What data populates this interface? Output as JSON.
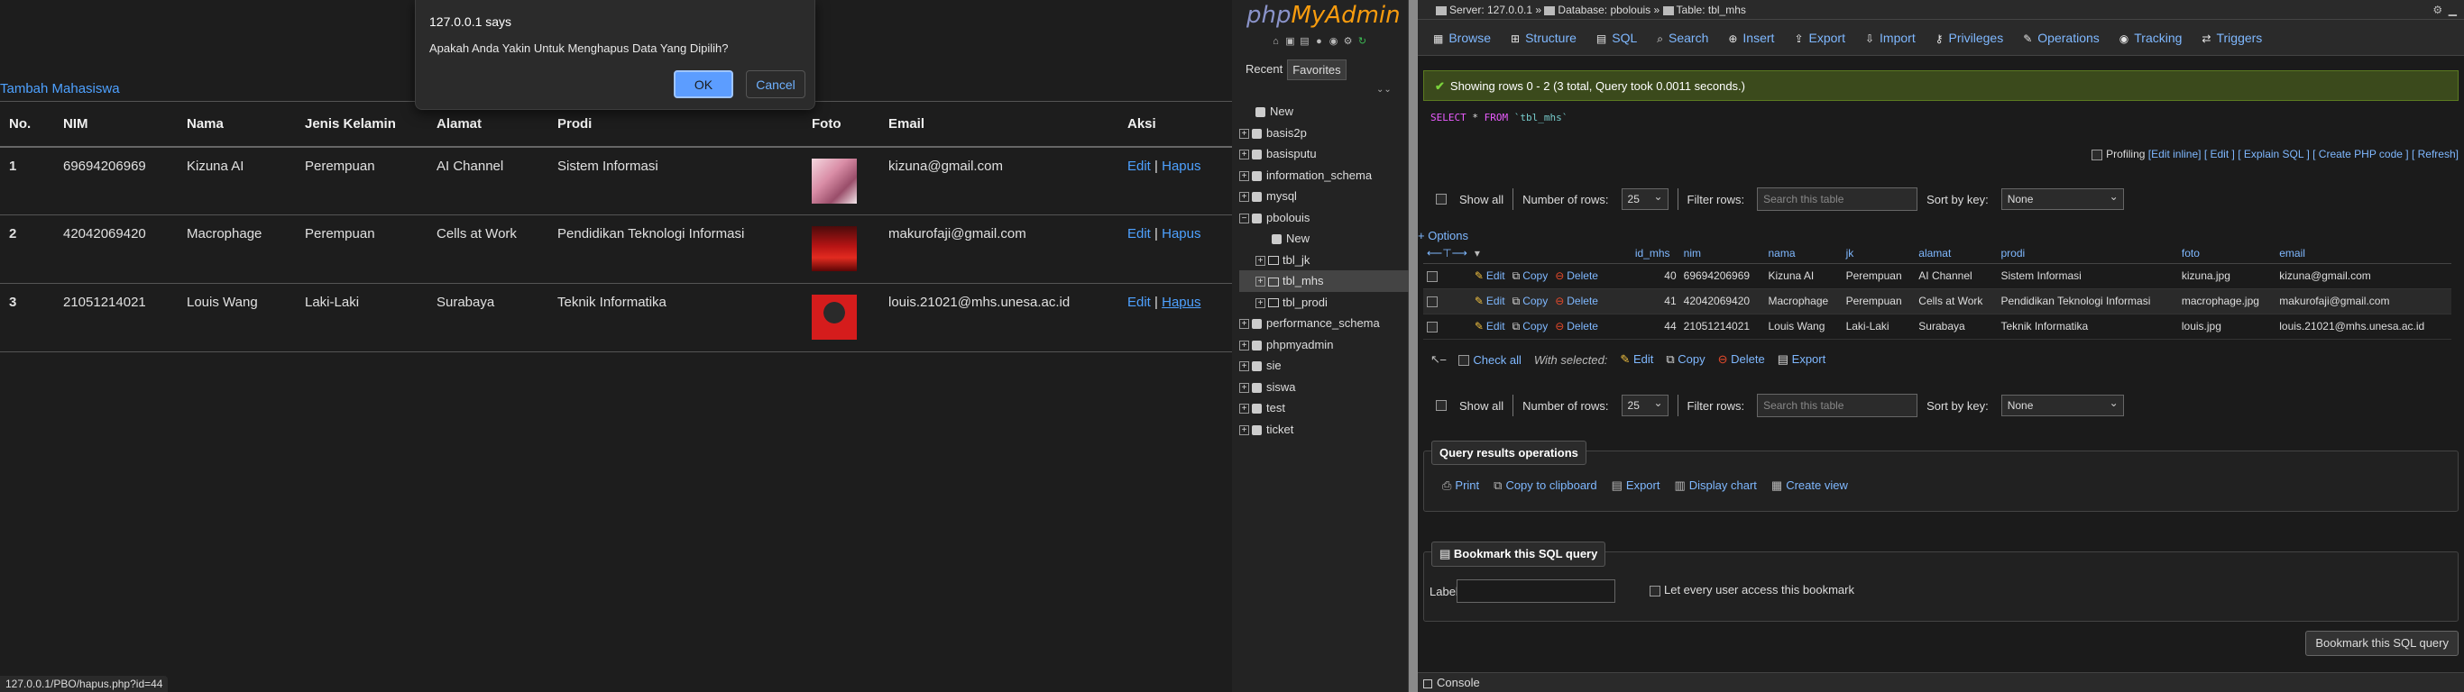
{
  "left": {
    "add_link": "Tambah Mahasiswa",
    "headers": [
      "No.",
      "NIM",
      "Nama",
      "Jenis Kelamin",
      "Alamat",
      "Prodi",
      "Foto",
      "Email",
      "Aksi"
    ],
    "rows": [
      {
        "no": "1",
        "nim": "69694206969",
        "nama": "Kizuna AI",
        "jk": "Perempuan",
        "alamat": "AI Channel",
        "prodi": "Sistem Informasi",
        "email": "kizuna@gmail.com",
        "edit": "Edit",
        "sep": "|",
        "hapus": "Hapus"
      },
      {
        "no": "2",
        "nim": "42042069420",
        "nama": "Macrophage",
        "jk": "Perempuan",
        "alamat": "Cells at Work",
        "prodi": "Pendidikan Teknologi Informasi",
        "email": "makurofaji@gmail.com",
        "edit": "Edit",
        "sep": "|",
        "hapus": "Hapus"
      },
      {
        "no": "3",
        "nim": "21051214021",
        "nama": "Louis Wang",
        "jk": "Laki-Laki",
        "alamat": "Surabaya",
        "prodi": "Teknik Informatika",
        "email": "louis.21021@mhs.unesa.ac.id",
        "edit": "Edit",
        "sep": "|",
        "hapus": "Hapus"
      }
    ],
    "status_url": "127.0.0.1/PBO/hapus.php?id=44"
  },
  "dialog": {
    "title": "127.0.0.1 says",
    "message": "Apakah Anda Yakin Untuk Menghapus Data Yang Dipilih?",
    "ok": "OK",
    "cancel": "Cancel"
  },
  "pma": {
    "logo_php": "php",
    "logo_my": "MyAdmin",
    "nav_tabs": {
      "recent": "Recent",
      "favorites": "Favorites"
    },
    "tree": [
      {
        "label": "New",
        "level": 0,
        "type": "new"
      },
      {
        "label": "basis2p",
        "level": 0,
        "type": "db"
      },
      {
        "label": "basisputu",
        "level": 0,
        "type": "db"
      },
      {
        "label": "information_schema",
        "level": 0,
        "type": "db"
      },
      {
        "label": "mysql",
        "level": 0,
        "type": "db"
      },
      {
        "label": "pbolouis",
        "level": 0,
        "type": "db",
        "expanded": true
      },
      {
        "label": "New",
        "level": 1,
        "type": "new"
      },
      {
        "label": "tbl_jk",
        "level": 1,
        "type": "table"
      },
      {
        "label": "tbl_mhs",
        "level": 1,
        "type": "table",
        "selected": true
      },
      {
        "label": "tbl_prodi",
        "level": 1,
        "type": "table"
      },
      {
        "label": "performance_schema",
        "level": 0,
        "type": "db"
      },
      {
        "label": "phpmyadmin",
        "level": 0,
        "type": "db"
      },
      {
        "label": "sie",
        "level": 0,
        "type": "db"
      },
      {
        "label": "siswa",
        "level": 0,
        "type": "db"
      },
      {
        "label": "test",
        "level": 0,
        "type": "db"
      },
      {
        "label": "ticket",
        "level": 0,
        "type": "db"
      }
    ],
    "breadcrumb": {
      "server": "Server: 127.0.0.1 »",
      "database": "Database: pbolouis »",
      "table": "Table: tbl_mhs"
    },
    "tabs": [
      "Browse",
      "Structure",
      "SQL",
      "Search",
      "Insert",
      "Export",
      "Import",
      "Privileges",
      "Operations",
      "Tracking",
      "Triggers"
    ],
    "success": "Showing rows 0 - 2 (3 total, Query took 0.0011 seconds.)",
    "sql": {
      "select": "SELECT",
      "star": "*",
      "from": "FROM",
      "table": "`tbl_mhs`"
    },
    "profiling": {
      "label": "Profiling",
      "links": [
        "[Edit inline]",
        "[ Edit ]",
        "[ Explain SQL ]",
        "[ Create PHP code ]",
        "[ Refresh]"
      ]
    },
    "controls": {
      "show_all": "Show all",
      "num_rows_label": "Number of rows:",
      "num_rows_value": "25",
      "filter_label": "Filter rows:",
      "filter_placeholder": "Search this table",
      "sort_label": "Sort by key:",
      "sort_value": "None"
    },
    "options": "+ Options",
    "columns": [
      "id_mhs",
      "nim",
      "nama",
      "jk",
      "alamat",
      "prodi",
      "foto",
      "email"
    ],
    "row_actions": {
      "edit": "Edit",
      "copy": "Copy",
      "delete": "Delete"
    },
    "rows": [
      {
        "id_mhs": "40",
        "nim": "69694206969",
        "nama": "Kizuna AI",
        "jk": "Perempuan",
        "alamat": "AI Channel",
        "prodi": "Sistem Informasi",
        "foto": "kizuna.jpg",
        "email": "kizuna@gmail.com"
      },
      {
        "id_mhs": "41",
        "nim": "42042069420",
        "nama": "Macrophage",
        "jk": "Perempuan",
        "alamat": "Cells at Work",
        "prodi": "Pendidikan Teknologi Informasi",
        "foto": "macrophage.jpg",
        "email": "makurofaji@gmail.com"
      },
      {
        "id_mhs": "44",
        "nim": "21051214021",
        "nama": "Louis Wang",
        "jk": "Laki-Laki",
        "alamat": "Surabaya",
        "prodi": "Teknik Informatika",
        "foto": "louis.jpg",
        "email": "louis.21021@mhs.unesa.ac.id"
      }
    ],
    "bulk": {
      "check_all": "Check all",
      "with_selected": "With selected:",
      "edit": "Edit",
      "copy": "Copy",
      "delete": "Delete",
      "export": "Export"
    },
    "qro": {
      "title": "Query results operations",
      "links": [
        "Print",
        "Copy to clipboard",
        "Export",
        "Display chart",
        "Create view"
      ]
    },
    "bookmark": {
      "title": "Bookmark this SQL query",
      "label": "Label:",
      "share": "Let every user access this bookmark",
      "submit": "Bookmark this SQL query"
    },
    "console": "Console"
  }
}
